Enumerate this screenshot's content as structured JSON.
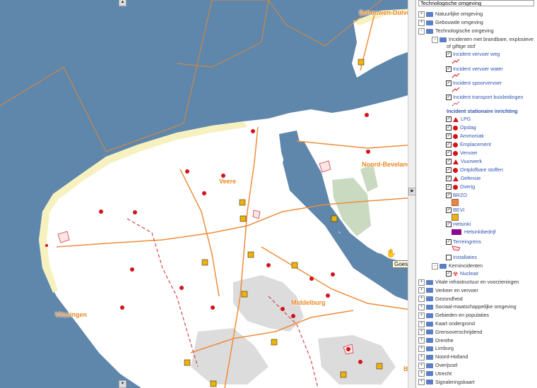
{
  "search": {
    "value": "Technologische omgeving"
  },
  "map": {
    "places": [
      "Schouwen-Duiveland",
      "Noord-Beveland",
      "Veere",
      "Middelburg",
      "Vlissingen",
      "Bors"
    ],
    "tooltip": "Goes"
  },
  "tree": {
    "top": [
      "Natuurlijke omgeving",
      "Gebouwde omgeving",
      "Technologische omgeving"
    ],
    "incidents_group": "Incidenten met brandbare, explosieve of giftige stof",
    "incidents_group_line1": "Incidenten met brandbare, explosieve",
    "incidents_group_line2": "of giftige stof",
    "transport": [
      "Incident vervoer weg",
      "Incident vervoer water",
      "Incident spoorvervoer",
      "Incident transport buisleidingen"
    ],
    "stationary_header": "Incident stationaire inrichting",
    "stationary": [
      "LPG",
      "Opslag",
      "Ammoniak",
      "Emplacement",
      "Vervoer",
      "Vuurwerk",
      "Ontplofbare stoffen",
      "Defensie",
      "Overig"
    ],
    "brzo": "BRZO",
    "bevi": "BEVI",
    "helsinki": "Helsinki",
    "helsinki_company": "Helsinkibedrijf",
    "terrain": "Terreingrens",
    "installations": "Installaties",
    "nuclear_group": "Kernincidenten",
    "nuclear": "Nucleair",
    "bottom": [
      "Vitale infrastructuur en voorzieningen",
      "Verkeer en vervoer",
      "Gezondheid",
      "Sociaal-maatschappelijke omgeving",
      "Gebieden en populaties",
      "Kaart ondergrond",
      "Grensoverschrijdend",
      "Drenthe",
      "Limburg",
      "Noord-Holland",
      "Overijssel",
      "Utrecht",
      "Signaleringskaart"
    ]
  },
  "colors": {
    "water": "#5f86ab",
    "land": "#ffffff",
    "dune": "#f6f1bf",
    "road": "#ef8c3a",
    "marker": "#d3141b",
    "link": "#2f55b0"
  }
}
